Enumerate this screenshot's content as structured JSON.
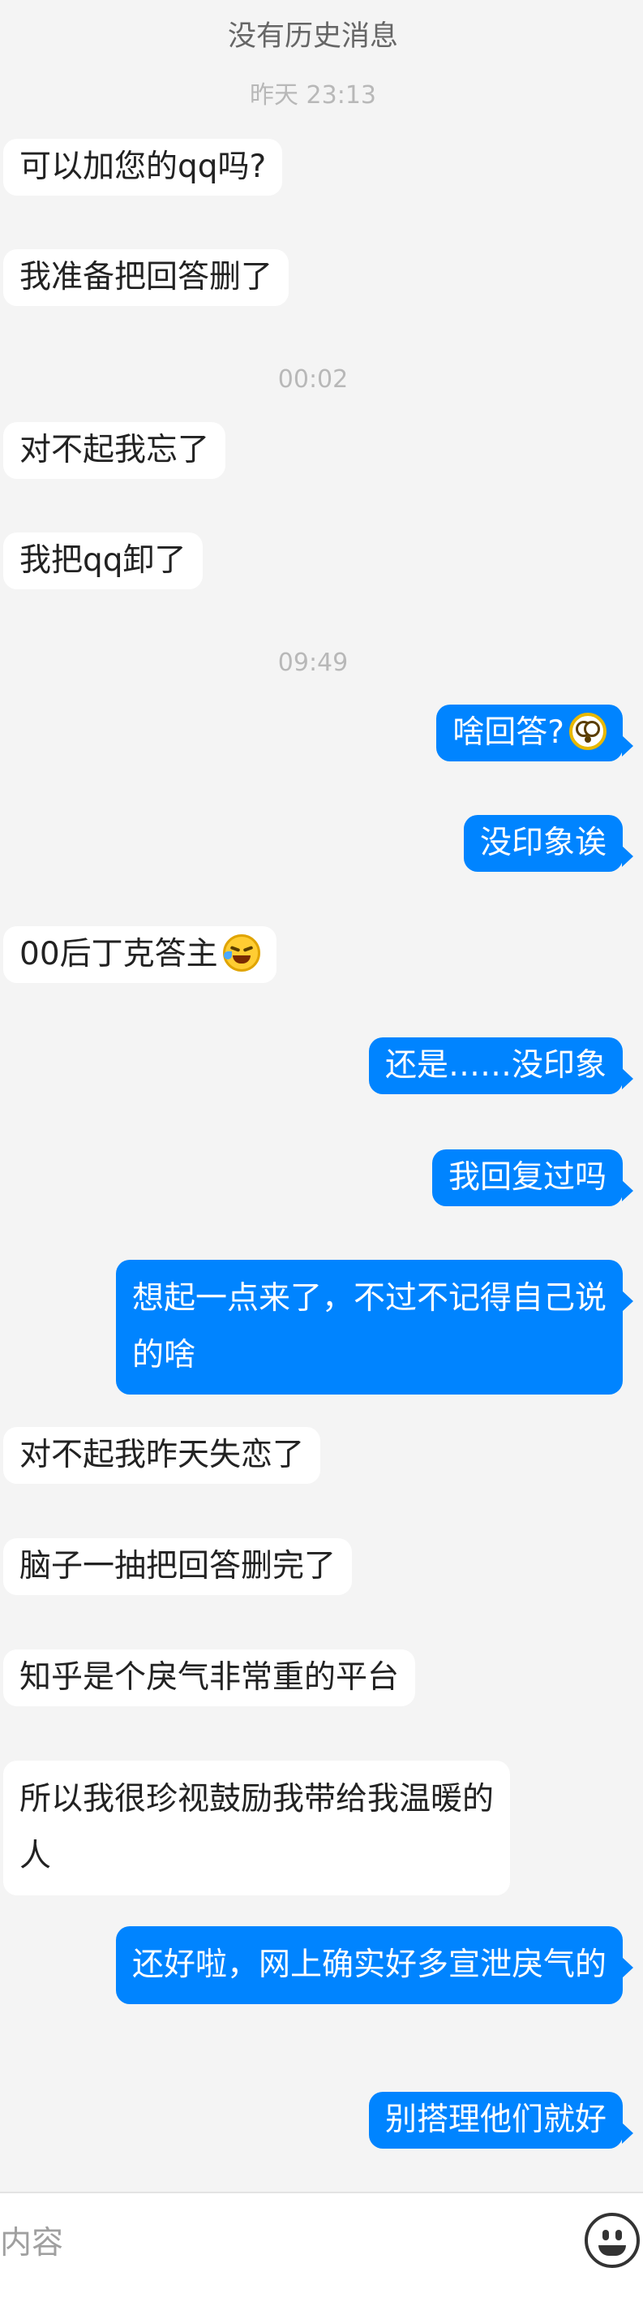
{
  "header": {
    "history_note": "没有历史消息"
  },
  "timestamps": [
    {
      "label": "昨天 23:13"
    },
    {
      "label": "00:02"
    },
    {
      "label": "09:49"
    }
  ],
  "messages": [
    {
      "side": "left",
      "text": "可以加您的qq吗?"
    },
    {
      "side": "left",
      "text": "我准备把回答删了"
    },
    {
      "side": "left",
      "text": "对不起我忘了"
    },
    {
      "side": "left",
      "text": "我把qq卸了"
    },
    {
      "side": "right",
      "text": "啥回答?",
      "emoji": "thinking-face-icon"
    },
    {
      "side": "right",
      "text": "没印象诶"
    },
    {
      "side": "left",
      "text": "00后丁克答主",
      "emoji": "laughing-tears-icon"
    },
    {
      "side": "right",
      "text": "还是……没印象"
    },
    {
      "side": "right",
      "text": "我回复过吗"
    },
    {
      "side": "right",
      "text": "想起一点来了，不过不记得自己说的啥"
    },
    {
      "side": "left",
      "text": "对不起我昨天失恋了"
    },
    {
      "side": "left",
      "text": "脑子一抽把回答删完了"
    },
    {
      "side": "left",
      "text": "知乎是个戾气非常重的平台"
    },
    {
      "side": "left",
      "text": "所以我很珍视鼓励我带给我温暖的人"
    },
    {
      "side": "right",
      "text": "还好啦，网上确实好多宣泄戾气的"
    },
    {
      "side": "right",
      "text": "别搭理他们就好"
    }
  ],
  "input_bar": {
    "placeholder": "内容",
    "value": "",
    "emoji_button_icon": "smiley-icon"
  },
  "colors": {
    "background": "#f4f4f4",
    "incoming_bubble": "#ffffff",
    "outgoing_bubble": "#0084ff",
    "timestamp_text": "#b8b8b8"
  }
}
